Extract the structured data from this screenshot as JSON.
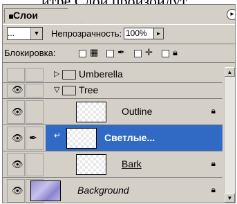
{
  "page": {
    "top_text": "итре Слои произойдут"
  },
  "panel": {
    "tab_label": "Слои",
    "blend_mode": "...",
    "opacity_label": "Непрозрачность:",
    "opacity_value": "100%",
    "lock_label": "Блокировка:"
  },
  "layers": [
    {
      "name": "Umberella",
      "type": "group",
      "expanded": false,
      "visible": false
    },
    {
      "name": "Tree",
      "type": "group",
      "expanded": true,
      "visible": true
    },
    {
      "name": "Outline",
      "type": "layer",
      "visible": true,
      "locked": true
    },
    {
      "name": "Светлые...",
      "type": "layer",
      "visible": true,
      "selected": true,
      "clipped": true,
      "brush": true
    },
    {
      "name": "Bark",
      "type": "layer",
      "visible": true,
      "locked": true
    },
    {
      "name": "Background",
      "type": "layer",
      "visible": true,
      "locked": true
    }
  ],
  "icons": {
    "eye": "eye-icon",
    "lock": "lock-icon",
    "brush": "brush-icon",
    "folder": "folder-icon"
  }
}
